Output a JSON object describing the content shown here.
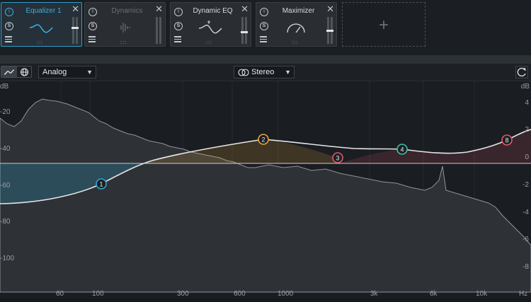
{
  "modules": [
    {
      "title": "Equalizer 1",
      "power": "I",
      "solo": "S",
      "state": "active"
    },
    {
      "title": "Dynamics",
      "power": "I",
      "solo": "S",
      "state": "disabled"
    },
    {
      "title": "Dynamic EQ",
      "power": "I",
      "solo": "S",
      "state": "normal"
    },
    {
      "title": "Maximizer",
      "power": "I",
      "solo": "S",
      "state": "normal"
    }
  ],
  "add_slot": "+",
  "toolbar": {
    "mode": "Analog",
    "channel": "Stereo"
  },
  "graph": {
    "left_db_label": "dB",
    "right_db_label": "dB",
    "left_scale": [
      "-20",
      "-40",
      "-60",
      "-80",
      "-100"
    ],
    "right_scale": [
      "4",
      "2",
      "0",
      "-2",
      "-4",
      "-6",
      "-8"
    ],
    "freq_labels": [
      "60",
      "100",
      "300",
      "600",
      "1000",
      "3k",
      "6k",
      "10k",
      "Hz"
    ],
    "nodes": [
      {
        "label": "1",
        "color": "#2aa7d8"
      },
      {
        "label": "2",
        "color": "#e5a53a"
      },
      {
        "label": "3",
        "color": "#e2586a"
      },
      {
        "label": "4",
        "color": "#3cc1a8"
      },
      {
        "label": "8",
        "color": "#e2586a"
      }
    ]
  },
  "colors": {
    "accent": "#39b1e3",
    "curve": "#e6e6e6"
  }
}
